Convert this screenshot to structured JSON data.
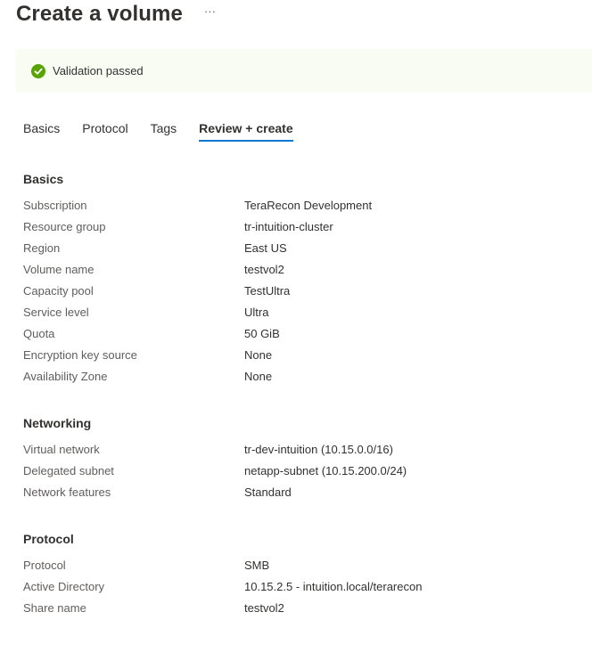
{
  "header": {
    "title": "Create a volume",
    "more": "···"
  },
  "banner": {
    "text": "Validation passed",
    "color": "#57a300",
    "icon": "checkmark-circle-icon"
  },
  "tabs": [
    {
      "label": "Basics"
    },
    {
      "label": "Protocol"
    },
    {
      "label": "Tags"
    },
    {
      "label": "Review + create",
      "active": true
    }
  ],
  "sections": {
    "basics": {
      "title": "Basics",
      "rows": [
        {
          "label": "Subscription",
          "value": "TeraRecon Development"
        },
        {
          "label": "Resource group",
          "value": "tr-intuition-cluster"
        },
        {
          "label": "Region",
          "value": "East US"
        },
        {
          "label": "Volume name",
          "value": "testvol2"
        },
        {
          "label": "Capacity pool",
          "value": "TestUltra"
        },
        {
          "label": "Service level",
          "value": "Ultra"
        },
        {
          "label": "Quota",
          "value": "50 GiB"
        },
        {
          "label": "Encryption key source",
          "value": "None"
        },
        {
          "label": "Availability Zone",
          "value": "None"
        }
      ]
    },
    "networking": {
      "title": "Networking",
      "rows": [
        {
          "label": "Virtual network",
          "value": "tr-dev-intuition (10.15.0.0/16)"
        },
        {
          "label": "Delegated subnet",
          "value": "netapp-subnet (10.15.200.0/24)"
        },
        {
          "label": "Network features",
          "value": "Standard"
        }
      ]
    },
    "protocol": {
      "title": "Protocol",
      "rows": [
        {
          "label": "Protocol",
          "value": "SMB"
        },
        {
          "label": "Active Directory",
          "value": "10.15.2.5 - intuition.local/terarecon"
        },
        {
          "label": "Share name",
          "value": "testvol2"
        }
      ]
    }
  }
}
